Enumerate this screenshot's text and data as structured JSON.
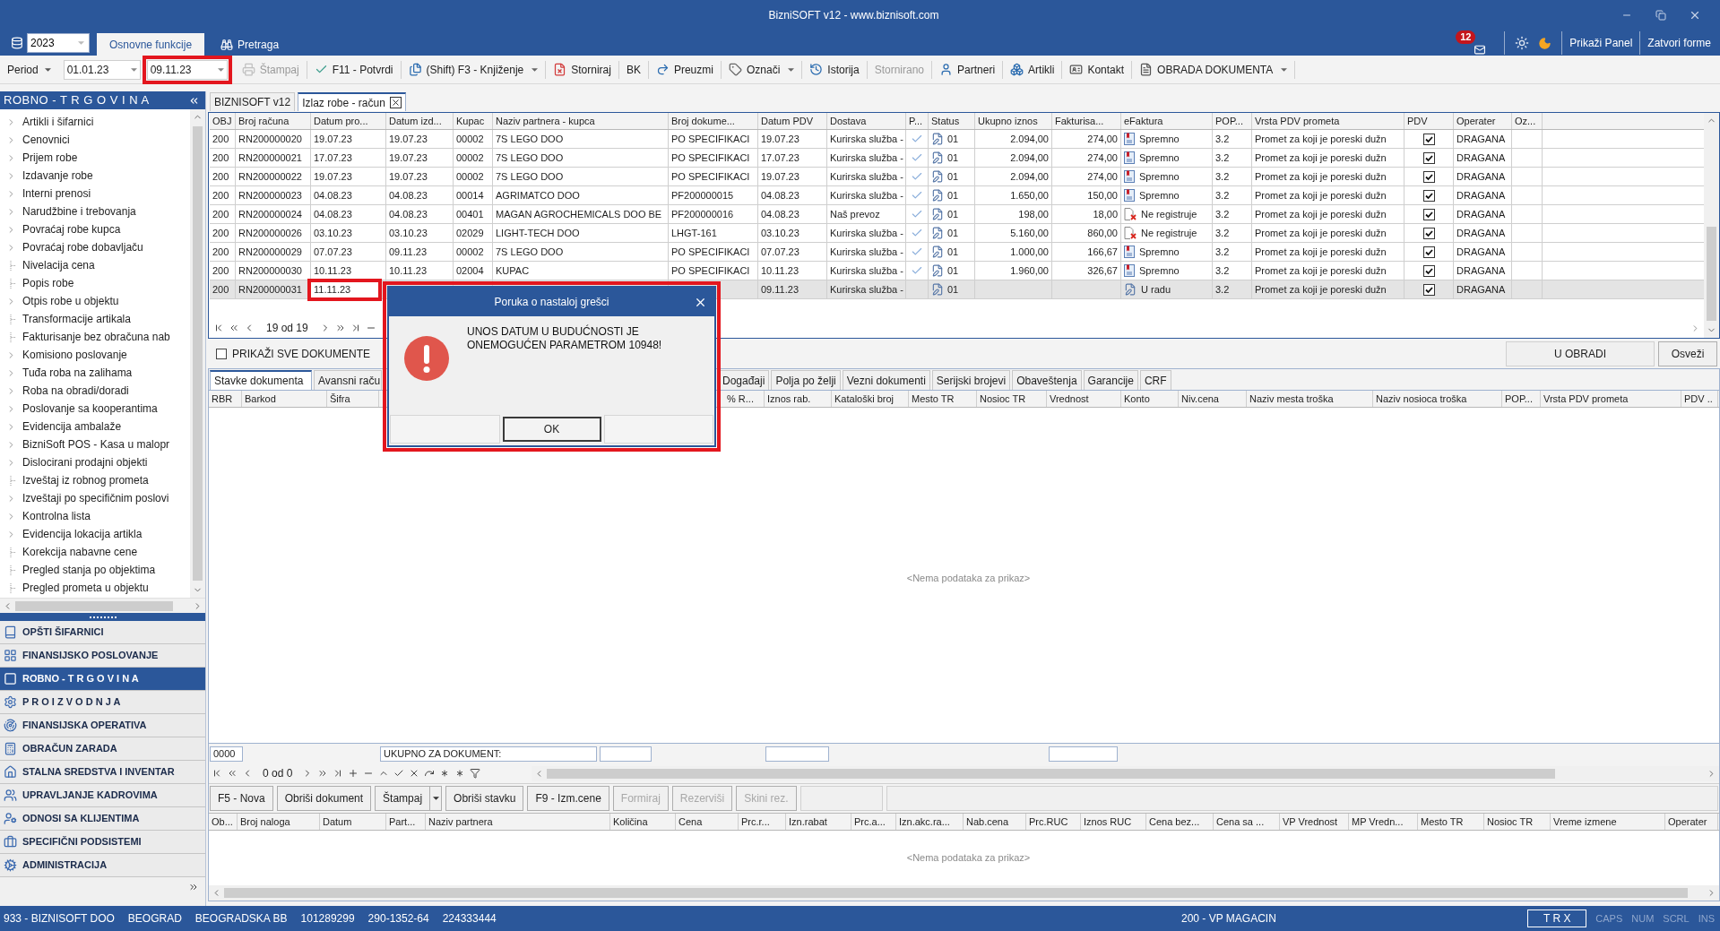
{
  "window": {
    "title": "BizniSOFT v12 - www.biznisoft.com"
  },
  "top_bar": {
    "year": "2023",
    "ribbon_tabs": [
      {
        "label": "Osnovne funkcije",
        "selected": true
      },
      {
        "label": "Pretraga",
        "selected": false
      }
    ],
    "notifications": "12",
    "buttons": [
      "Prikaži Panel",
      "Zatvori forme"
    ]
  },
  "toolbar": {
    "period": {
      "label": "Period",
      "from": "01.01.23",
      "to": "09.11.23",
      "to_highlighted": true
    },
    "items": [
      {
        "label": "Štampaj",
        "disabled": true,
        "has_menu": false
      },
      {
        "label": "F11 - Potvrdi",
        "disabled": false,
        "has_menu": false
      },
      {
        "label": "(Shift) F3 - Knjiženje",
        "disabled": false,
        "has_menu": true
      },
      {
        "label": "Storniraj",
        "disabled": false,
        "has_menu": false
      },
      {
        "label": "BK",
        "disabled": false,
        "has_menu": false
      },
      {
        "label": "Preuzmi",
        "disabled": false,
        "has_menu": false
      },
      {
        "label": "Označi",
        "disabled": false,
        "has_menu": true
      },
      {
        "label": "Istorija",
        "disabled": false,
        "has_menu": false
      },
      {
        "label": "Stornirano",
        "disabled": true,
        "has_menu": false
      },
      {
        "label": "Partneri",
        "disabled": false,
        "has_menu": false
      },
      {
        "label": "Artikli",
        "disabled": false,
        "has_menu": false
      },
      {
        "label": "Kontakt",
        "disabled": false,
        "has_menu": false
      },
      {
        "label": "OBRADA DOKUMENTA",
        "disabled": false,
        "has_menu": true
      }
    ]
  },
  "sidebar": {
    "title": "ROBNO - T R G O V I N A",
    "tree": [
      {
        "label": "Artikli i šifarnici",
        "kind": "folder"
      },
      {
        "label": "Cenovnici",
        "kind": "folder"
      },
      {
        "label": "Prijem robe",
        "kind": "folder"
      },
      {
        "label": "Izdavanje robe",
        "kind": "folder"
      },
      {
        "label": "Interni prenosi",
        "kind": "folder"
      },
      {
        "label": "Narudžbine i trebovanja",
        "kind": "folder"
      },
      {
        "label": "Povraćaj robe kupca",
        "kind": "folder"
      },
      {
        "label": "Povraćaj robe dobavljaču",
        "kind": "folder"
      },
      {
        "label": "Nivelacija cena",
        "kind": "leaf"
      },
      {
        "label": "Popis robe",
        "kind": "leaf"
      },
      {
        "label": "Otpis robe u objektu",
        "kind": "folder"
      },
      {
        "label": "Transformacije artikala",
        "kind": "leaf"
      },
      {
        "label": "Fakturisanje bez obračuna nab",
        "kind": "leaf"
      },
      {
        "label": "Komisiono poslovanje",
        "kind": "folder"
      },
      {
        "label": "Tuđa roba na zalihama",
        "kind": "folder"
      },
      {
        "label": "Roba na obradi/doradi",
        "kind": "folder"
      },
      {
        "label": "Poslovanje sa kooperantima",
        "kind": "folder"
      },
      {
        "label": "Evidencija ambalaže",
        "kind": "folder"
      },
      {
        "label": "BizniSoft POS - Kasa u malopr",
        "kind": "folder"
      },
      {
        "label": "Dislocirani prodajni objekti",
        "kind": "folder"
      },
      {
        "label": "Izveštaj iz robnog prometa",
        "kind": "leaf"
      },
      {
        "label": "Izveštaji po specifičnim poslovi",
        "kind": "folder"
      },
      {
        "label": "Kontrolna lista",
        "kind": "folder"
      },
      {
        "label": "Evidencija lokacija artikla",
        "kind": "folder"
      },
      {
        "label": "Korekcija nabavne cene",
        "kind": "leaf"
      },
      {
        "label": "Pregled stanja po objektima",
        "kind": "leaf"
      },
      {
        "label": "Pregled prometa u objektu",
        "kind": "leaf"
      }
    ],
    "modules": [
      {
        "label": "OPŠTI ŠIFARNICI",
        "selected": false
      },
      {
        "label": "FINANSIJSKO POSLOVANJE",
        "selected": false
      },
      {
        "label": "ROBNO - T R G O V I N A",
        "selected": true
      },
      {
        "label": "P R O I Z V O D N J A",
        "selected": false
      },
      {
        "label": "FINANSIJSKA OPERATIVA",
        "selected": false
      },
      {
        "label": "OBRAČUN ZARADA",
        "selected": false
      },
      {
        "label": "STALNA SREDSTVA I INVENTAR",
        "selected": false
      },
      {
        "label": "UPRAVLJANJE KADROVIMA",
        "selected": false
      },
      {
        "label": "ODNOSI SA KLIJENTIMA",
        "selected": false
      },
      {
        "label": "SPECIFIČNI PODSISTEMI",
        "selected": false
      },
      {
        "label": "ADMINISTRACIJA",
        "selected": false
      }
    ]
  },
  "document_tabs": [
    {
      "label": "BIZNISOFT v12",
      "selected": false,
      "closable": false
    },
    {
      "label": "Izlaz robe - račun",
      "selected": true,
      "closable": true
    }
  ],
  "documents_grid": {
    "columns": [
      "OBJ",
      "Broj računa",
      "Datum pro...",
      "Datum izd...",
      "Kupac",
      "Naziv partnera - kupca",
      "Broj dokume...",
      "Datum PDV",
      "Dostava",
      "P...",
      "Status",
      "Ukupno iznos",
      "Fakturisa...",
      "eFaktura",
      "POP...",
      "Vrsta PDV prometa",
      "PDV",
      "Operater",
      "Oz..."
    ],
    "rows": [
      {
        "obj": "200",
        "invoice_number": "RN200000020",
        "date_1": "19.07.23",
        "date_2": "19.07.23",
        "customer_code": "00002",
        "partner": "7S LEGO DOO",
        "document_number": "PO SPECIFIKACI",
        "vat_date": "19.07.23",
        "delivery": "Kurirska služba -",
        "p_checked": true,
        "status": "01",
        "total": "2.094,00",
        "invoiced": "274,00",
        "efaktura": {
          "label": "Spremno",
          "kind": "ready"
        },
        "pop": "3.2",
        "vat_type": "Promet za koji je poreski dužn",
        "vat_checked": true,
        "operator": "DRAGANA",
        "selected": false,
        "editing": false
      },
      {
        "obj": "200",
        "invoice_number": "RN200000021",
        "date_1": "17.07.23",
        "date_2": "19.07.23",
        "customer_code": "00002",
        "partner": "7S LEGO DOO",
        "document_number": "PO SPECIFIKACI",
        "vat_date": "17.07.23",
        "delivery": "Kurirska služba -",
        "p_checked": true,
        "status": "01",
        "total": "2.094,00",
        "invoiced": "274,00",
        "efaktura": {
          "label": "Spremno",
          "kind": "ready"
        },
        "pop": "3.2",
        "vat_type": "Promet za koji je poreski dužn",
        "vat_checked": true,
        "operator": "DRAGANA",
        "selected": false,
        "editing": false
      },
      {
        "obj": "200",
        "invoice_number": "RN200000022",
        "date_1": "19.07.23",
        "date_2": "19.07.23",
        "customer_code": "00002",
        "partner": "7S LEGO DOO",
        "document_number": "PO SPECIFIKACI",
        "vat_date": "19.07.23",
        "delivery": "Kurirska služba -",
        "p_checked": true,
        "status": "01",
        "total": "2.094,00",
        "invoiced": "274,00",
        "efaktura": {
          "label": "Spremno",
          "kind": "ready"
        },
        "pop": "3.2",
        "vat_type": "Promet za koji je poreski dužn",
        "vat_checked": true,
        "operator": "DRAGANA",
        "selected": false,
        "editing": false
      },
      {
        "obj": "200",
        "invoice_number": "RN200000023",
        "date_1": "04.08.23",
        "date_2": "04.08.23",
        "customer_code": "00014",
        "partner": "AGRIMATCO  DOO",
        "document_number": "PF200000015",
        "vat_date": "04.08.23",
        "delivery": "Kurirska služba -",
        "p_checked": true,
        "status": "01",
        "total": "1.650,00",
        "invoiced": "150,00",
        "efaktura": {
          "label": "Spremno",
          "kind": "ready"
        },
        "pop": "3.2",
        "vat_type": "Promet za koji je poreski dužn",
        "vat_checked": true,
        "operator": "DRAGANA",
        "selected": false,
        "editing": false
      },
      {
        "obj": "200",
        "invoice_number": "RN200000024",
        "date_1": "04.08.23",
        "date_2": "04.08.23",
        "customer_code": "00401",
        "partner": "MAGAN AGROCHEMICALS DOO BE",
        "document_number": "PF200000016",
        "vat_date": "04.08.23",
        "delivery": "Naš prevoz",
        "p_checked": true,
        "status": "01",
        "total": "198,00",
        "invoiced": "18,00",
        "efaktura": {
          "label": "Ne registruje",
          "kind": "not_registered"
        },
        "pop": "3.2",
        "vat_type": "Promet za koji je poreski dužn",
        "vat_checked": true,
        "operator": "DRAGANA",
        "selected": false,
        "editing": false
      },
      {
        "obj": "200",
        "invoice_number": "RN200000026",
        "date_1": "03.10.23",
        "date_2": "03.10.23",
        "customer_code": "02029",
        "partner": "LIGHT-TECH DOO",
        "document_number": "LHGT-161",
        "vat_date": "03.10.23",
        "delivery": "Kurirska služba -",
        "p_checked": true,
        "status": "01",
        "total": "5.160,00",
        "invoiced": "860,00",
        "efaktura": {
          "label": "Ne registruje",
          "kind": "not_registered"
        },
        "pop": "3.2",
        "vat_type": "Promet za koji je poreski dužn",
        "vat_checked": true,
        "operator": "DRAGANA",
        "selected": false,
        "editing": false
      },
      {
        "obj": "200",
        "invoice_number": "RN200000029",
        "date_1": "07.07.23",
        "date_2": "09.11.23",
        "customer_code": "00002",
        "partner": "7S LEGO DOO",
        "document_number": "PO SPECIFIKACI",
        "vat_date": "07.07.23",
        "delivery": "Kurirska služba -",
        "p_checked": true,
        "status": "01",
        "total": "1.000,00",
        "invoiced": "166,67",
        "efaktura": {
          "label": "Spremno",
          "kind": "ready"
        },
        "pop": "3.2",
        "vat_type": "Promet za koji je poreski dužn",
        "vat_checked": true,
        "operator": "DRAGANA",
        "selected": false,
        "editing": false
      },
      {
        "obj": "200",
        "invoice_number": "RN200000030",
        "date_1": "10.11.23",
        "date_2": "10.11.23",
        "customer_code": "02004",
        "partner": "KUPAC",
        "document_number": "PO SPECIFIKACI",
        "vat_date": "10.11.23",
        "delivery": "Kurirska služba -",
        "p_checked": true,
        "status": "01",
        "total": "1.960,00",
        "invoiced": "326,67",
        "efaktura": {
          "label": "Spremno",
          "kind": "ready"
        },
        "pop": "3.2",
        "vat_type": "Promet za koji je poreski dužn",
        "vat_checked": true,
        "operator": "DRAGANA",
        "selected": false,
        "editing": false
      },
      {
        "obj": "200",
        "invoice_number": "RN200000031",
        "date_1": "11.11.23",
        "vat_date": "09.11.23",
        "delivery": "Kurirska služba -",
        "p_checked": false,
        "status": "01",
        "efaktura": {
          "label": "U radu",
          "kind": "draft"
        },
        "pop": "3.2",
        "vat_type": "Promet za koji je poreski dužn",
        "vat_checked": true,
        "operator": "DRAGANA",
        "selected": true,
        "editing": true
      }
    ],
    "pager": "19 od 19"
  },
  "show_all_documents": {
    "label": "PRIKAŽI SVE DOKUMENTE",
    "checked": false
  },
  "status_label": "U OBRADI",
  "refresh_button": "Osveži",
  "detail_tabs": [
    {
      "label": "Stavke dokumenta",
      "selected": true
    },
    {
      "label": "Avansni raču",
      "selected": false
    },
    {
      "label": "Događaji",
      "selected": false
    },
    {
      "label": "Polja po želji",
      "selected": false
    },
    {
      "label": "Vezni dokumenti",
      "selected": false
    },
    {
      "label": "Serijski brojevi",
      "selected": false
    },
    {
      "label": "Obaveštenja",
      "selected": false
    },
    {
      "label": "Garancije",
      "selected": false
    },
    {
      "label": "CRF",
      "selected": false
    }
  ],
  "items_grid": {
    "columns": [
      "RBR",
      "Barkod",
      "Šifra",
      "% R...",
      "Iznos rab.",
      "Kataloški broj",
      "Mesto TR",
      "Nosioc TR",
      "Vrednost",
      "Konto",
      "Niv.cena",
      "Naziv mesta troška",
      "Naziv nosioca troška",
      "POP...",
      "Vrsta PDV prometa",
      "PDV .."
    ],
    "empty_text": "<Nema podataka za prikaz>",
    "footer": {
      "code": "0000",
      "total_label": "UKUPNO ZA DOKUMENT:"
    },
    "pager": "0 od 0"
  },
  "action_buttons": [
    {
      "label": "F5 - Nova",
      "disabled": false,
      "has_menu": false
    },
    {
      "label": "Obriši dokument",
      "disabled": false,
      "has_menu": false
    },
    {
      "label": "Štampaj",
      "disabled": false,
      "has_menu": true
    },
    {
      "label": "Obriši stavku",
      "disabled": false,
      "has_menu": false
    },
    {
      "label": "F9 - Izm.cene",
      "disabled": false,
      "has_menu": false
    },
    {
      "label": "Formiraj",
      "disabled": true,
      "has_menu": false
    },
    {
      "label": "Rezerviši",
      "disabled": true,
      "has_menu": false
    },
    {
      "label": "Skini rez.",
      "disabled": true,
      "has_menu": false
    }
  ],
  "orders_grid": {
    "columns": [
      "Ob...",
      "Broj naloga",
      "Datum",
      "Part...",
      "Naziv partnera",
      "Količina",
      "Cena",
      "Prc.r...",
      "Izn.rabat",
      "Prc.a...",
      "Izn.akc.ra...",
      "Nab.cena",
      "Prc.RUC",
      "Iznos RUC",
      "Cena bez...",
      "Cena sa ...",
      "VP Vrednost",
      "MP Vredn...",
      "Mesto TR",
      "Nosioc TR",
      "Vreme izmene",
      "Operater"
    ],
    "empty_text": "<Nema podataka za prikaz>"
  },
  "status_bar": {
    "company": [
      "933 - BIZNISOFT DOO",
      "BEOGRAD",
      "BEOGRADSKA BB",
      "101289299",
      "290-1352-64",
      "224333444"
    ],
    "warehouse": "200 - VP MAGACIN",
    "mode": "T R X",
    "indicators": [
      {
        "label": "CAPS",
        "on": false
      },
      {
        "label": "NUM",
        "on": false
      },
      {
        "label": "SCRL",
        "on": false
      },
      {
        "label": "INS",
        "on": false
      }
    ]
  },
  "dialog": {
    "title": "Poruka o nastaloj grešci",
    "message": "UNOS DATUM U BUDUĆNOSTI JE ONEMOGUĆEN PARAMETROM 10948!",
    "button": "OK",
    "highlighted": true
  }
}
